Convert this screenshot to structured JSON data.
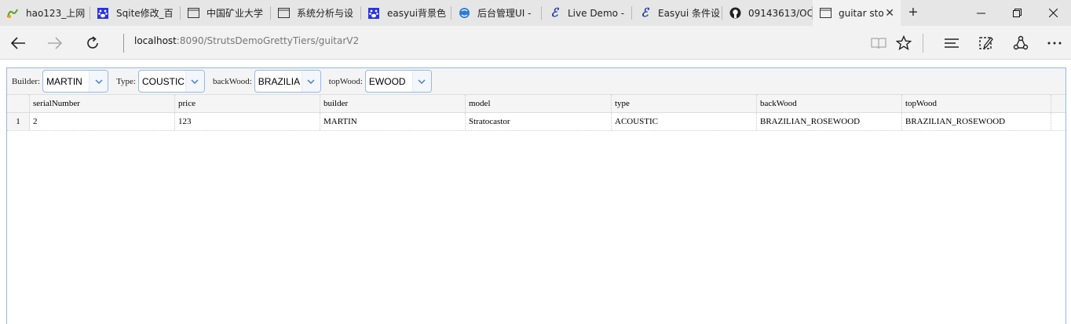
{
  "browser": {
    "tabs": [
      {
        "label": "hao123_上网",
        "icon": "hao123-icon",
        "active": false
      },
      {
        "label": "Sqite修改_百",
        "icon": "baidu-paw-icon",
        "active": false
      },
      {
        "label": "中国矿业大学",
        "icon": "page-icon",
        "active": false
      },
      {
        "label": "系统分析与设",
        "icon": "page-icon",
        "active": false
      },
      {
        "label": "easyui背景色",
        "icon": "baidu-paw-icon",
        "active": false
      },
      {
        "label": "后台管理UI -",
        "icon": "globe-icon",
        "active": false
      },
      {
        "label": "Live Demo -",
        "icon": "easyui-e-icon",
        "active": false
      },
      {
        "label": "Easyui 条件设",
        "icon": "easyui-e-icon",
        "active": false
      },
      {
        "label": "09143613/OC",
        "icon": "github-icon",
        "active": false
      },
      {
        "label": "guitar sto",
        "icon": "page-icon",
        "active": true
      }
    ],
    "address": {
      "host": "localhost",
      "rest": ":8090/StrutsDemoGrettyTiers/guitarV2"
    }
  },
  "toolbar": {
    "builder_label": "Builder:",
    "builder_value": "MARTIN",
    "type_label": "Type:",
    "type_value": "COUSTIC",
    "backwood_label": "backWood:",
    "backwood_value": "BRAZILIA",
    "topwood_label": "topWood:",
    "topwood_value": "EWOOD"
  },
  "grid": {
    "columns": [
      "serialNumber",
      "price",
      "builder",
      "model",
      "type",
      "backWood",
      "topWood"
    ],
    "rows": [
      {
        "num": "1",
        "cells": [
          "2",
          "123",
          "MARTIN",
          "Stratocastor",
          "ACOUSTIC",
          "BRAZILIAN_ROSEWOOD",
          "BRAZILIAN_ROSEWOOD"
        ]
      }
    ]
  },
  "colors": {
    "accent_border": "#95b8e7",
    "tab_bar": "#e6e6e6",
    "nav_bar": "#f2f2f2"
  }
}
